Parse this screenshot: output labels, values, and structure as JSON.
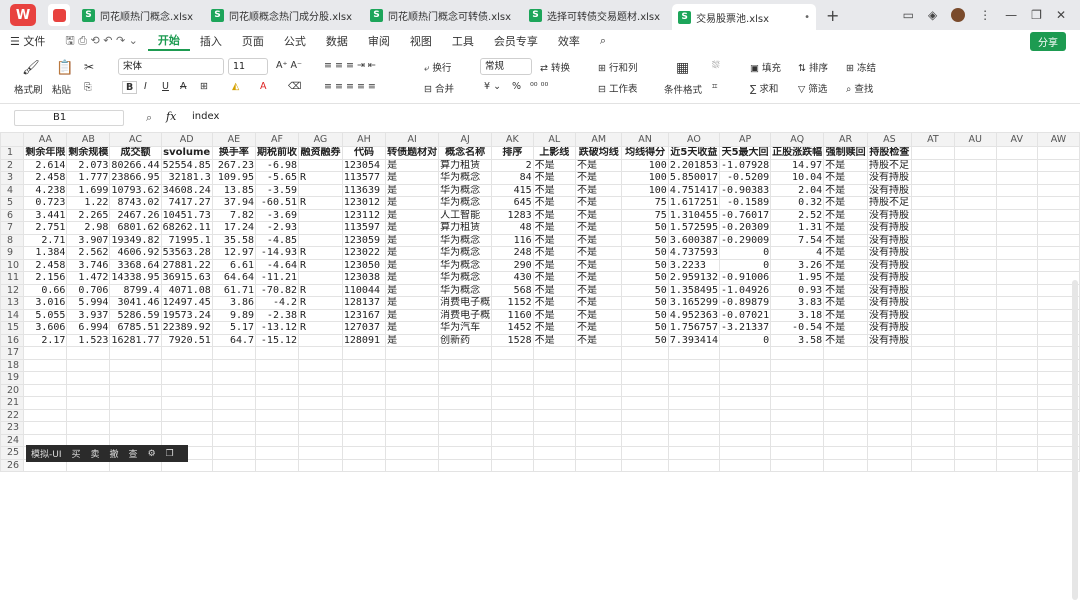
{
  "titlebar": {
    "logo_text": "W",
    "tabs": [
      {
        "label": "同花顺热门概念.xlsx"
      },
      {
        "label": "同花顺概念热门成分股.xlsx"
      },
      {
        "label": "同花顺热门概念可转债.xlsx"
      },
      {
        "label": "选择可转债交易题材.xlsx"
      },
      {
        "label": "交易股票池.xlsx",
        "active": true
      }
    ],
    "new_tab": "+"
  },
  "menu": {
    "file": "文件",
    "items": [
      "开始",
      "插入",
      "页面",
      "公式",
      "数据",
      "审阅",
      "视图",
      "工具",
      "会员专享",
      "效率"
    ],
    "active": "开始",
    "share": "分享"
  },
  "ribbon": {
    "format_painter": "格式刷",
    "paste": "粘贴",
    "font_name": "宋体",
    "font_size": "11",
    "bold": "B",
    "italic": "I",
    "underline": "U",
    "strike": "A",
    "wrap": "换行",
    "merge": "合并",
    "number_format": "常规",
    "convert": "转换",
    "percent": "%",
    "rows_cols": "行和列",
    "worksheet": "工作表",
    "cond_format": "条件格式",
    "fill": "填充",
    "sort": "排序",
    "freeze": "冻结",
    "sum": "求和",
    "filter": "筛选",
    "find": "查找"
  },
  "formula": {
    "cell_ref": "B1",
    "fx": "fx",
    "content": "index"
  },
  "columns": [
    "AA",
    "AB",
    "AC",
    "AD",
    "AE",
    "AF",
    "AG",
    "AH",
    "AI",
    "AJ",
    "AK",
    "AL",
    "AM",
    "AN",
    "AO",
    "AP",
    "AQ",
    "AR",
    "AS",
    "AT",
    "AU",
    "AV",
    "AW"
  ],
  "headers": [
    "剩余年限",
    "剩余规模",
    "成交额",
    "svolume",
    "换手率",
    "期税前收",
    "融资融券",
    "代码",
    "转债题材对",
    "概念名称",
    "排序",
    "上影线",
    "跌破均线",
    "均线得分",
    "近5天收益",
    "天5最大回",
    "正股涨跌幅",
    "强制赎回",
    "持股检查"
  ],
  "rows": [
    [
      "2.614",
      "2.073",
      "80266.44",
      "52554.85",
      "267.23",
      "-6.98",
      "",
      "123054",
      "是",
      "算力租赁",
      "2",
      "不是",
      "不是",
      "100",
      "2.201853",
      "-1.07928",
      "14.97",
      "不是",
      "持股不足"
    ],
    [
      "2.458",
      "1.777",
      "23866.95",
      "32181.3",
      "109.95",
      "-5.65",
      "R",
      "113577",
      "是",
      "华为概念",
      "84",
      "不是",
      "不是",
      "100",
      "5.850017",
      "-0.5209",
      "10.04",
      "不是",
      "没有持股"
    ],
    [
      "4.238",
      "1.699",
      "10793.62",
      "34608.24",
      "13.85",
      "-3.59",
      "",
      "113639",
      "是",
      "华为概念",
      "415",
      "不是",
      "不是",
      "100",
      "4.751417",
      "-0.90383",
      "2.04",
      "不是",
      "没有持股"
    ],
    [
      "0.723",
      "1.22",
      "8743.02",
      "7417.27",
      "37.94",
      "-60.51",
      "R",
      "123012",
      "是",
      "华为概念",
      "645",
      "不是",
      "不是",
      "75",
      "1.617251",
      "-0.1589",
      "0.32",
      "不是",
      "持股不足"
    ],
    [
      "3.441",
      "2.265",
      "2467.26",
      "10451.73",
      "7.82",
      "-3.69",
      "",
      "123112",
      "是",
      "人工智能",
      "1283",
      "不是",
      "不是",
      "75",
      "1.310455",
      "-0.76017",
      "2.52",
      "不是",
      "没有持股"
    ],
    [
      "2.751",
      "2.98",
      "6801.62",
      "68262.11",
      "17.24",
      "-2.93",
      "",
      "113597",
      "是",
      "算力租赁",
      "48",
      "不是",
      "不是",
      "50",
      "1.572595",
      "-0.20309",
      "1.31",
      "不是",
      "没有持股"
    ],
    [
      "2.71",
      "3.907",
      "19349.82",
      "71995.1",
      "35.58",
      "-4.85",
      "",
      "123059",
      "是",
      "华为概念",
      "116",
      "不是",
      "不是",
      "50",
      "3.600387",
      "-0.29009",
      "7.54",
      "不是",
      "没有持股"
    ],
    [
      "1.384",
      "2.562",
      "4606.92",
      "53563.28",
      "12.97",
      "-14.93",
      "R",
      "123022",
      "是",
      "华为概念",
      "248",
      "不是",
      "不是",
      "50",
      "4.737593",
      "0",
      "4",
      "不是",
      "没有持股"
    ],
    [
      "2.458",
      "3.746",
      "3368.64",
      "27881.22",
      "6.61",
      "-4.64",
      "R",
      "123050",
      "是",
      "华为概念",
      "290",
      "不是",
      "不是",
      "50",
      "3.2233",
      "0",
      "3.26",
      "不是",
      "没有持股"
    ],
    [
      "2.156",
      "1.472",
      "14338.95",
      "36915.63",
      "64.64",
      "-11.21",
      "",
      "123038",
      "是",
      "华为概念",
      "430",
      "不是",
      "不是",
      "50",
      "2.959132",
      "-0.91006",
      "1.95",
      "不是",
      "没有持股"
    ],
    [
      "0.66",
      "0.706",
      "8799.4",
      "4071.08",
      "61.71",
      "-70.82",
      "R",
      "110044",
      "是",
      "华为概念",
      "568",
      "不是",
      "不是",
      "50",
      "1.358495",
      "-1.04926",
      "0.93",
      "不是",
      "没有持股"
    ],
    [
      "3.016",
      "5.994",
      "3041.46",
      "12497.45",
      "3.86",
      "-4.2",
      "R",
      "128137",
      "是",
      "消费电子概",
      "1152",
      "不是",
      "不是",
      "50",
      "3.165299",
      "-0.89879",
      "3.83",
      "不是",
      "没有持股"
    ],
    [
      "5.055",
      "3.937",
      "5286.59",
      "19573.24",
      "9.89",
      "-2.38",
      "R",
      "123167",
      "是",
      "消费电子概",
      "1160",
      "不是",
      "不是",
      "50",
      "4.952363",
      "-0.07021",
      "3.18",
      "不是",
      "没有持股"
    ],
    [
      "3.606",
      "6.994",
      "6785.51",
      "22389.92",
      "5.17",
      "-13.12",
      "R",
      "127037",
      "是",
      "华为汽车",
      "1452",
      "不是",
      "不是",
      "50",
      "1.756757",
      "-3.21337",
      "-0.54",
      "不是",
      "没有持股"
    ],
    [
      "2.17",
      "1.523",
      "16281.77",
      "7920.51",
      "64.7",
      "-15.12",
      "",
      "128091",
      "是",
      "创新药",
      "1528",
      "不是",
      "不是",
      "50",
      "7.393414",
      "0",
      "3.58",
      "不是",
      "没有持股"
    ]
  ],
  "row_numbers": [
    "1",
    "2",
    "3",
    "4",
    "5",
    "6",
    "7",
    "8",
    "9",
    "10",
    "11",
    "12",
    "13",
    "14",
    "15",
    "16",
    "17",
    "18",
    "19",
    "20",
    "21",
    "22",
    "23",
    "24",
    "25",
    "26"
  ],
  "float_toolbar": [
    "模拟-UI",
    "买",
    "卖",
    "撤",
    "查",
    "⚙",
    "❐"
  ],
  "colors": {
    "accent": "#1d9b51",
    "brand": "#e8423f"
  }
}
